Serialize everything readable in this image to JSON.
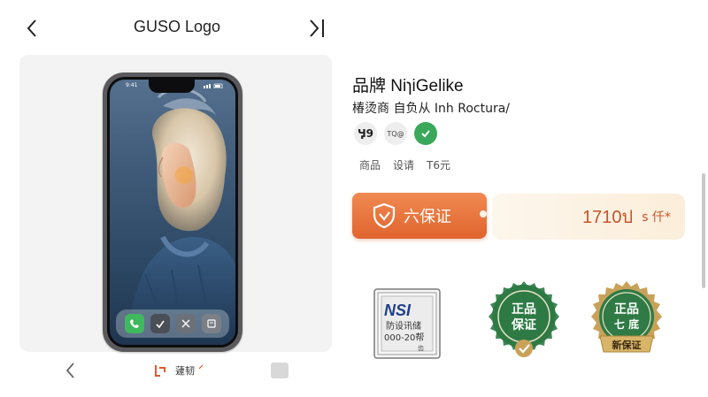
{
  "header": {
    "title": "GUSO Logo",
    "back_icon": "chevron-left-icon",
    "next_icon": "skip-next-icon"
  },
  "phone": {
    "status_time": "9:41",
    "dock_apps": [
      "phone-app-icon",
      "check-app-icon",
      "tools-app-icon",
      "notes-app-icon"
    ]
  },
  "bottom_bar": {
    "back_icon": "chevron-left-icon",
    "center_label": "蘧韧",
    "center_icon": "logo-mark-icon",
    "right_icon": "box-icon"
  },
  "product": {
    "brand": "品牌 NiɿiGelike",
    "subtitle": "椿烫商 自负从 Inh Roctura/",
    "badges": [
      {
        "text": "Ӌ9"
      },
      {
        "text": "TQ@"
      },
      {
        "icon": "check-icon",
        "color": "#3aa85a"
      }
    ],
    "tags": [
      "商品",
      "设请",
      "T6元"
    ]
  },
  "guarantee": {
    "label": "六保证",
    "icon": "shield-icon",
    "color": "#e86f36"
  },
  "price": {
    "value": "1710ป",
    "unit": "s 仟*",
    "color": "#c9532a"
  },
  "certificates": {
    "stamp_lines": [
      "NSI",
      "防设讯储",
      "000-20帮",
      "齿"
    ],
    "seal_1": {
      "top": "正品",
      "bottom": "保证",
      "color": "#2f7a45"
    },
    "seal_2": {
      "top": "正品",
      "middle": "七 底",
      "ribbon": "新保证",
      "color": "#2f7a45",
      "ribbon_color": "#c9a25a"
    }
  }
}
